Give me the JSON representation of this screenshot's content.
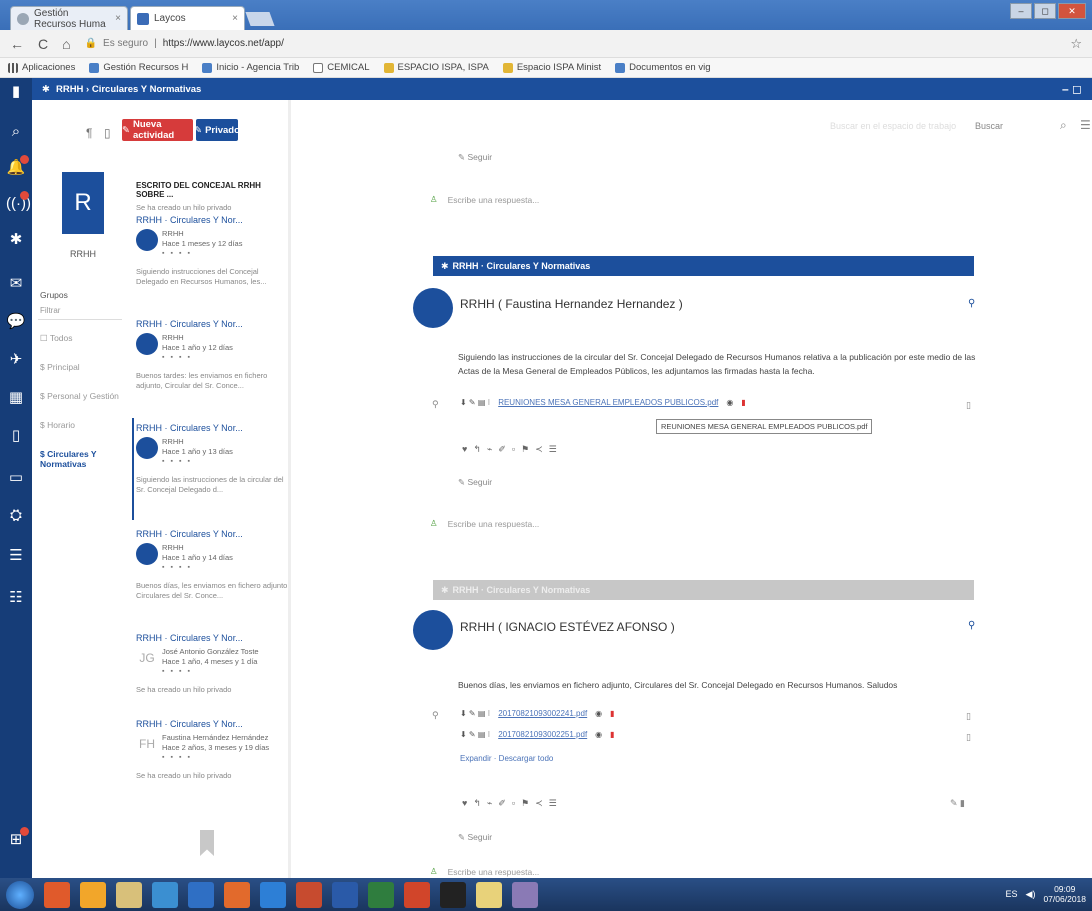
{
  "browser": {
    "tabs": [
      {
        "label": "Gestión Recursos Huma",
        "close": "×"
      },
      {
        "label": "Laycos",
        "close": "×"
      }
    ],
    "nav": {
      "back": "←",
      "forward": "C",
      "home": "⌂"
    },
    "url": {
      "secure": "Es seguro",
      "address": "https://www.laycos.net/app/"
    },
    "star": "☆",
    "bookmarks": [
      "Aplicaciones",
      "Gestión Recursos H",
      "Inicio - Agencia Trib",
      "CEMICAL",
      "ESPACIO ISPA, ISPA",
      "Espacio ISPA Minist",
      "Documentos en vig"
    ]
  },
  "app": {
    "title": "RRHH › Circulares Y Normativas",
    "header_controls": "– ◻",
    "colors": {
      "primary": "#1c4f9c",
      "danger": "#d63b3b"
    }
  },
  "toolbar": {
    "new_activity": "Nueva actividad",
    "private": "Privado",
    "search_placeholder": "Buscar en el espacio de trabajo",
    "search_button": "Buscar"
  },
  "user": {
    "initial": "R",
    "name": "RRHH",
    "groups_label": "Grupos",
    "filter_placeholder": "Filtrar",
    "groups": [
      "Todos",
      "Principal",
      "Personal y Gestión",
      "Horario",
      "Circulares Y Normativas"
    ]
  },
  "threads": [
    {
      "title": "ESCRITO DEL CONCEJAL RRHH SOBRE ...",
      "preview": "Se ha creado un hilo privado"
    },
    {
      "head": "RRHH · Circulares Y Nor...",
      "author": "RRHH",
      "time": "Hace 1 meses y 12 días",
      "preview": "Siguiendo instrucciones del Concejal Delegado en Recursos Humanos, les..."
    },
    {
      "head": "RRHH · Circulares Y Nor...",
      "author": "RRHH",
      "time": "Hace 1 año y 12 días",
      "preview": "Buenos tardes: les enviamos en fichero adjunto, Circular del Sr. Conce..."
    },
    {
      "head": "RRHH · Circulares Y Nor...",
      "author": "RRHH",
      "time": "Hace 1 año y 13 días",
      "preview": "Siguiendo las instrucciones de la circular del Sr. Concejal Delegado d..."
    },
    {
      "head": "RRHH · Circulares Y Nor...",
      "author": "RRHH",
      "time": "Hace 1 año y 14 días",
      "preview": "Buenos días, les enviamos en fichero adjunto Circulares del Sr. Conce..."
    },
    {
      "head": "RRHH · Circulares Y Nor...",
      "author": "José Antonio González Toste",
      "initials": "JG",
      "time": "Hace 1 año, 4 meses y 1 día",
      "preview": "Se ha creado un hilo privado"
    },
    {
      "head": "RRHH · Circulares Y Nor...",
      "author": "Faustina Hernández Hernández",
      "initials": "FH",
      "time": "Hace 2 años, 3 meses y 19 días",
      "preview": "Se ha creado un hilo privado"
    }
  ],
  "feed": {
    "follow": "Seguir",
    "reply_placeholder": "Escribe una respuesta...",
    "posts": [
      {
        "header": "RRHH · Circulares Y Normativas",
        "author": "RRHH ( Faustina Hernandez Hernandez )",
        "body": "Siguiendo las instrucciones de la circular del Sr. Concejal Delegado de Recursos Humanos relativa a la publicación por este medio de las Actas de la Mesa General de Empleados Públicos, les adjuntamos las firmadas hasta la fecha.",
        "attachments": [
          "REUNIONES MESA GENERAL EMPLEADOS PUBLICOS.pdf"
        ],
        "tooltip": "REUNIONES MESA GENERAL EMPLEADOS PUBLICOS.pdf"
      },
      {
        "header": "RRHH · Circulares Y Normativas",
        "author": "RRHH ( IGNACIO ESTÉVEZ AFONSO )",
        "body": "Buenos días, les enviamos en fichero adjunto, Circulares del Sr. Concejal Delegado en Recursos Humanos. Saludos",
        "attachments": [
          "20170821093002241.pdf",
          "20170821093002251.pdf"
        ],
        "links": "Expandir · Descargar todo"
      }
    ]
  },
  "taskbar": {
    "lang": "ES",
    "time": "09:09",
    "date": "07/06/2018"
  }
}
